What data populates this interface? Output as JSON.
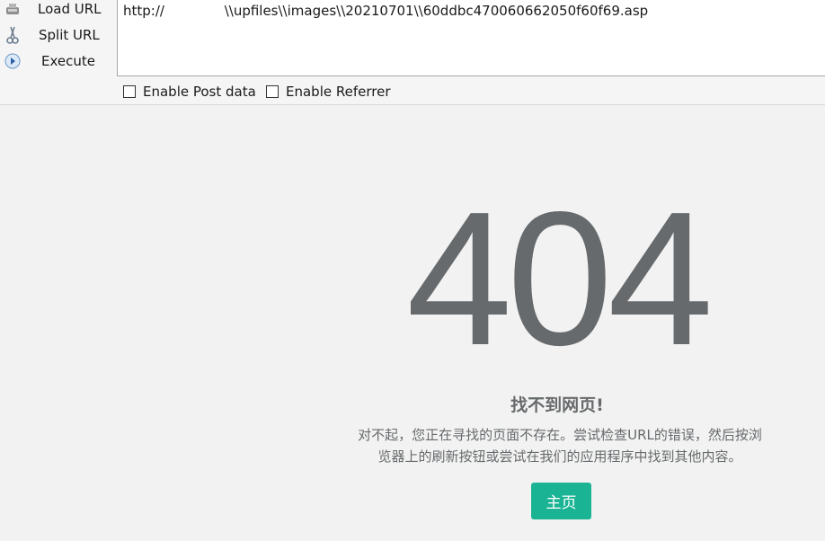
{
  "toolbar": {
    "load_url_label": "Load URL",
    "split_url_label": "Split URL",
    "execute_label": "Execute",
    "url_value": "http://              \\\\upfiles\\\\images\\\\20210701\\\\60ddbc470060662050f60f69.asp",
    "enable_post_label": "Enable Post data",
    "enable_referrer_label": "Enable Referrer"
  },
  "icons": {
    "load": "load-url-icon",
    "split": "split-url-icon",
    "execute": "execute-icon"
  },
  "page": {
    "error_code": "404",
    "title": "找不到网页!",
    "description_line1": "对不起，您正在寻找的页面不存在。尝试检查URL的错误，然后按浏",
    "description_line2": "览器上的刷新按钮或尝试在我们的应用程序中找到其他内容。",
    "home_button_label": "主页"
  },
  "colors": {
    "accent": "#1ab394",
    "text": "#676a6c",
    "background": "#f2f2f2"
  }
}
